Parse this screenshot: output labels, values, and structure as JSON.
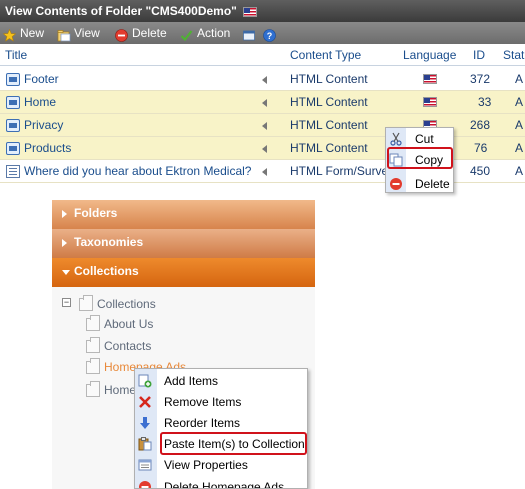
{
  "window": {
    "title": "View Contents of Folder \"CMS400Demo\""
  },
  "toolbar": {
    "new": "New",
    "view": "View",
    "delete": "Delete",
    "action": "Action"
  },
  "table": {
    "headers": {
      "title": "Title",
      "content_type": "Content Type",
      "language": "Language",
      "id": "ID",
      "status": "Statu"
    },
    "rows": [
      {
        "title": "Footer",
        "type": "HTML Content",
        "id": "372",
        "status": "A"
      },
      {
        "title": "Home",
        "type": "HTML Content",
        "id": "33",
        "status": "A"
      },
      {
        "title": "Privacy",
        "type": "HTML Content",
        "id": "268",
        "status": "A"
      },
      {
        "title": "Products",
        "type": "HTML Content",
        "id": "76",
        "status": "A"
      },
      {
        "title": "Where did you hear about Ektron Medical?",
        "type": "HTML Form/Survey",
        "id": "450",
        "status": "A"
      }
    ]
  },
  "context_menu_top": {
    "cut": "Cut",
    "copy": "Copy",
    "delete": "Delete"
  },
  "accordion": {
    "folders": "Folders",
    "taxonomies": "Taxonomies",
    "collections": "Collections"
  },
  "tree": {
    "root": "Collections",
    "items": [
      "About Us",
      "Contacts",
      "Homepage Ads",
      "Home"
    ]
  },
  "context_menu_bottom": {
    "add_items": "Add Items",
    "remove_items": "Remove Items",
    "reorder_items": "Reorder Items",
    "paste_items": "Paste Item(s) to Collection",
    "view_properties": "View Properties",
    "delete_homepage_ads": "Delete Homepage Ads"
  },
  "colors": {
    "highlight_row": "#f8f3c8",
    "accordion_active": "#d56510",
    "red_outline": "#d0121b"
  }
}
